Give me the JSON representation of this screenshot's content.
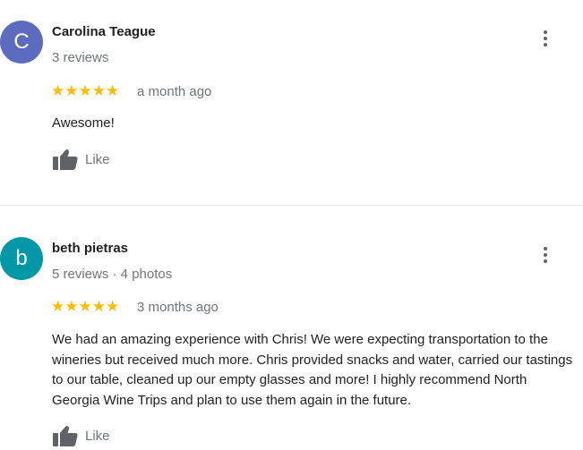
{
  "reviews": [
    {
      "avatar_letter": "C",
      "avatar_color": "#5c6bc0",
      "name": "Carolina Teague",
      "meta": "3 reviews",
      "rating": 5,
      "stars": "★★★★★",
      "date": "a month ago",
      "text": "Awesome!",
      "like_label": "Like",
      "more_icon": "more-vert-icon",
      "like_icon": "thumbs-up-icon"
    },
    {
      "avatar_letter": "b",
      "avatar_color": "#0097a7",
      "name": "beth pietras",
      "meta": "5 reviews · 4 photos",
      "rating": 5,
      "stars": "★★★★★",
      "date": "3 months ago",
      "text": "We had an amazing experience with Chris! We were expecting transportation to the wineries but received much more. Chris provided snacks and water, carried our tastings to our table, cleaned up our empty glasses and more! I highly recommend North Georgia Wine Trips and plan to use them again in the future.",
      "like_label": "Like",
      "more_icon": "more-vert-icon",
      "like_icon": "thumbs-up-icon"
    }
  ]
}
